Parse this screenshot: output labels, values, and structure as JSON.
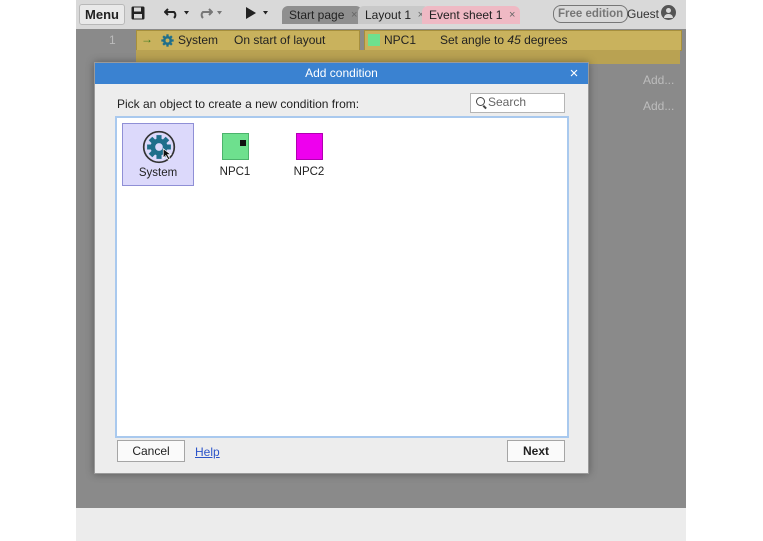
{
  "toolbar": {
    "menu_label": "Menu",
    "tabs": [
      {
        "label": "Start page",
        "color": "#8f8f8f"
      },
      {
        "label": "Layout 1",
        "color": "#c9c9c9"
      },
      {
        "label": "Event sheet 1",
        "color": "#efb9c4"
      }
    ],
    "tab_close_glyph": "×",
    "edition_badge": "Free edition",
    "user_label": "Guest"
  },
  "event_sheet": {
    "event_number": "1",
    "condition_object": "System",
    "condition_text": "On start of layout",
    "action_object": "NPC1",
    "action_text_prefix": "Set angle to ",
    "action_value": "45",
    "action_text_suffix": " degrees",
    "add_action_1": "Add...",
    "add_action_2": "Add..."
  },
  "dialog": {
    "title": "Add condition",
    "prompt": "Pick an object to create a new condition from:",
    "search_placeholder": "Search",
    "objects": [
      {
        "name": "System",
        "icon": "gear-icon",
        "selected": true
      },
      {
        "name": "NPC1",
        "icon": "sprite-icon",
        "color": "#6ee08e",
        "selected": false
      },
      {
        "name": "NPC2",
        "icon": "sprite-icon",
        "color": "#ee00ee",
        "selected": false
      }
    ],
    "cancel_label": "Cancel",
    "help_label": "Help",
    "next_label": "Next"
  },
  "colors": {
    "title_bar": "#3a82d1",
    "selection": "#dcd9fb",
    "condition_block": "#c9b25d"
  }
}
